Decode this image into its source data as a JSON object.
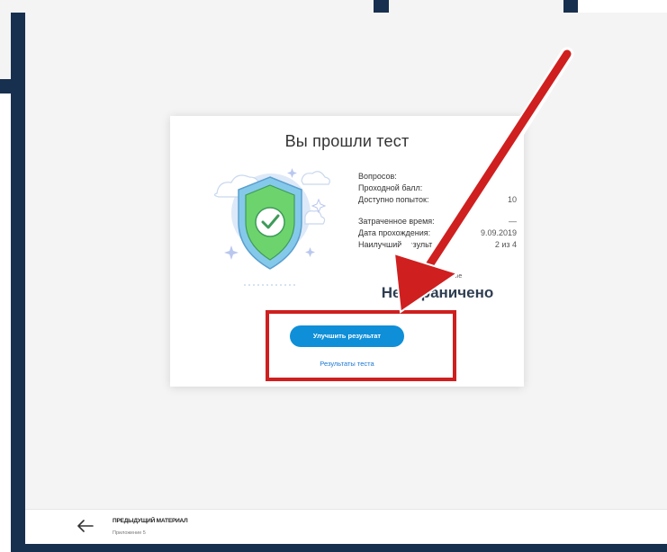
{
  "card": {
    "title": "Вы прошли тест",
    "stats": [
      {
        "label": "Вопросов:",
        "value": ""
      },
      {
        "label": "Проходной балл:",
        "value": ""
      },
      {
        "label": "Доступно попыток:",
        "value": "10"
      },
      {
        "label": "Затраченное время:",
        "value": "—"
      },
      {
        "label": "Дата прохождения:",
        "value": "9.09.2019"
      },
      {
        "label": "Наилучший результ",
        "value": "2 из 4"
      }
    ],
    "time_label": "Время  хождение",
    "time_value": "Не ограничено",
    "improve_button": "Улучшить результат",
    "results_link": "Результаты теста"
  },
  "footer": {
    "title": "ПРЕДЫДУЩИЙ МАТЕРИАЛ",
    "subtitle": "Приложение 5"
  },
  "colors": {
    "navy": "#18304f",
    "accent_blue": "#0f8fd8",
    "highlight_red": "#cf1f1f",
    "shield_green": "#6dd46d"
  },
  "icons": {
    "illustration": "shield-check-icon",
    "back": "arrow-left-icon",
    "annotation": "red-arrow-icon"
  }
}
